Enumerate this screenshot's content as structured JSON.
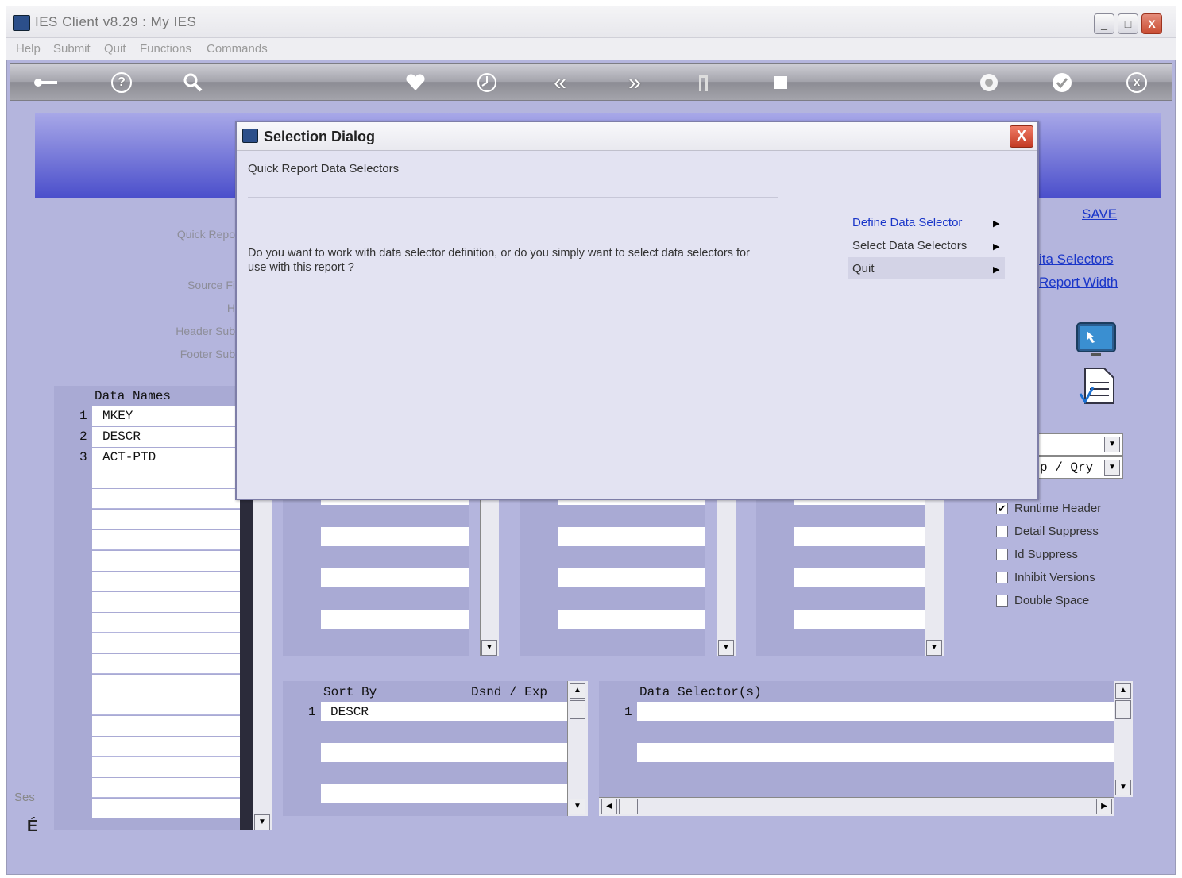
{
  "window": {
    "title": "IES Client v8.29 : My IES",
    "min_label": "_",
    "max_label": "□",
    "close_label": "X"
  },
  "menu": [
    "Help",
    "Submit",
    "Quit",
    "Functions",
    "Commands"
  ],
  "toolbar": {
    "icons": [
      "key-icon",
      "help-icon",
      "search-icon",
      "heart-icon",
      "clock-icon",
      "rewind-icon",
      "forward-icon",
      "tree-icon",
      "stop-icon",
      "recycle-icon",
      "check-icon",
      "close-icon"
    ],
    "help_glyph": "?",
    "rewind_glyph": "«",
    "forward_glyph": "»",
    "close_glyph": "x",
    "check_glyph": "✓"
  },
  "form": {
    "labels": {
      "quick_report": "Quick Repo",
      "source_file": "Source Fi",
      "h": "H",
      "header_sub": "Header Sub",
      "footer_sub": "Footer Sub"
    },
    "save_link": "SAVE",
    "data_selectors_link": "ita Selectors",
    "report_width_link": "Report Width",
    "dropdown_2_value": "p / Qry"
  },
  "data_names": {
    "header": "Data Names",
    "rows": [
      {
        "num": "1",
        "name": "MKEY"
      },
      {
        "num": "2",
        "name": "DESCR"
      },
      {
        "num": "3",
        "name": "ACT-PTD"
      }
    ]
  },
  "sort_grid": {
    "header_sort": "Sort By",
    "header_dsnd": "Dsnd / Exp",
    "rows": [
      {
        "num": "1",
        "value": "DESCR"
      }
    ]
  },
  "selector_grid": {
    "header": "Data Selector(s)",
    "rows": [
      {
        "num": "1",
        "value": ""
      }
    ]
  },
  "checkboxes": [
    {
      "label": "Runtime Header",
      "checked": true
    },
    {
      "label": "Detail Suppress",
      "checked": false
    },
    {
      "label": "Id Suppress",
      "checked": false
    },
    {
      "label": "Inhibit Versions",
      "checked": false
    },
    {
      "label": "Double Space",
      "checked": false
    }
  ],
  "status": {
    "left_fragment": "Ses",
    "glyph": "É"
  },
  "dialog": {
    "title": "Selection Dialog",
    "subtitle": "Quick Report Data Selectors",
    "question_line1": "Do you want to work with data selector definition, or do you simply want to select data selectors for",
    "question_line2": "use with this report ?",
    "options": [
      {
        "label": "Define Data Selector",
        "highlight": true
      },
      {
        "label": "Select Data Selectors",
        "highlight": false
      },
      {
        "label": "Quit",
        "highlight": false
      }
    ],
    "close_label": "X",
    "arrow_glyph": "▶"
  },
  "colors": {
    "background": "#b4b5dd",
    "header_band_top": "#a8a8e8",
    "header_band_bottom": "#4a4ecb",
    "link": "#1a36c9",
    "dialog_bg": "#e3e3f2"
  }
}
